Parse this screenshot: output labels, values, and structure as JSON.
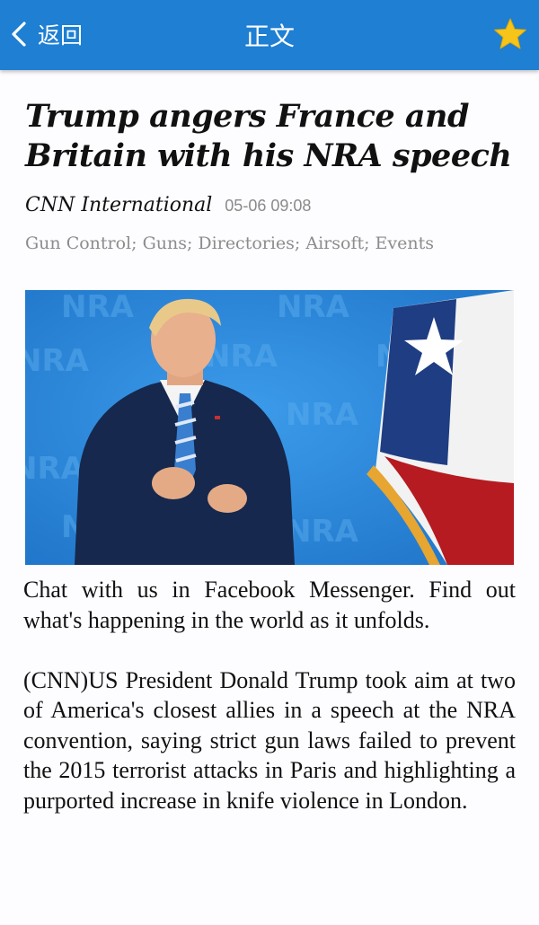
{
  "header": {
    "back_label": "返回",
    "title": "正文",
    "icons": {
      "back": "chevron-left-icon",
      "favorite": "star-icon"
    },
    "colors": {
      "bar": "#1e7fd3",
      "star": "#f7c51a"
    }
  },
  "article": {
    "headline": "Trump angers France and Britain with his NRA speech",
    "source": "CNN International",
    "date": "05-06 09:08",
    "tags": "Gun Control; Guns; Directories; Airsoft; Events",
    "image_alt": "Donald Trump speaking at the NRA convention",
    "paragraphs": [
      "Chat with us in Facebook Messenger. Find out what's happening in the world as it unfolds.",
      "(CNN)US President Donald Trump took aim at two of America's closest allies in a speech at the NRA convention, saying strict gun laws failed to prevent the 2015 terrorist attacks in Paris and highlighting a purported increase in knife violence in London."
    ]
  }
}
